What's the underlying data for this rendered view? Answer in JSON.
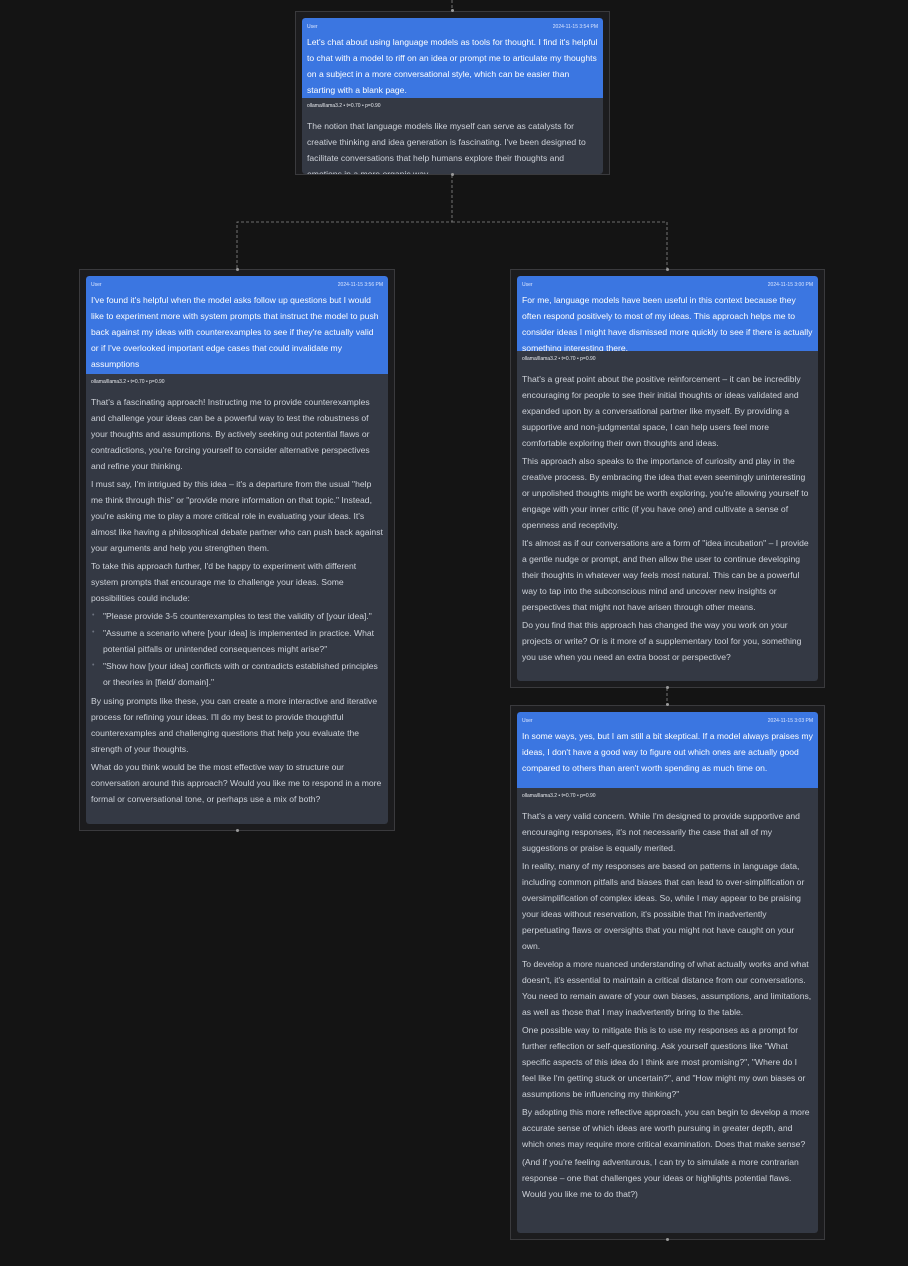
{
  "nodes": {
    "root": {
      "user": {
        "role": "User",
        "timestamp": "2024-11-15 3:54 PM",
        "text": "Let's chat about using language models as tools for thought. I find it's helpful to chat with a model to riff on an idea or prompt me to articulate my thoughts on a subject in a more conversational style, which can be easier than starting with a blank page."
      },
      "assistant": {
        "model": "ollama/llama3.2 • t=0.70 • p=0.90",
        "paragraphs": [
          "The notion that language models like myself can serve as catalysts for creative thinking and idea generation is fascinating. I've been designed to facilitate conversations that help humans explore their thoughts and emotions in a more organic way."
        ]
      }
    },
    "left": {
      "user": {
        "role": "User",
        "timestamp": "2024-11-15 3:56 PM",
        "text": "I've found it's helpful when the model asks follow up questions but I would like to experiment more with system prompts that instruct the model to push back against my ideas with counterexamples to see if they're actually valid or if I've overlooked important edge cases that could invalidate my assumptions"
      },
      "assistant": {
        "model": "ollama/llama3.2 • t=0.70 • p=0.90",
        "p1": "That's a fascinating approach! Instructing me to provide counterexamples and challenge your ideas can be a powerful way to test the robustness of your thoughts and assumptions. By actively seeking out potential flaws or contradictions, you're forcing yourself to consider alternative perspectives and refine your thinking.",
        "p2": "I must say, I'm intrigued by this idea – it's a departure from the usual \"help me think through this\" or \"provide more information on that topic.\" Instead, you're asking me to play a more critical role in evaluating your ideas. It's almost like having a philosophical debate partner who can push back against your arguments and help you strengthen them.",
        "p3": "To take this approach further, I'd be happy to experiment with different system prompts that encourage me to challenge your ideas. Some possibilities could include:",
        "bullets": [
          "\"Please provide 3-5 counterexamples to test the validity of [your idea].\"",
          "\"Assume a scenario where [your idea] is implemented in practice. What potential pitfalls or unintended consequences might arise?\"",
          "\"Show how [your idea] conflicts with or contradicts established principles or theories in [field/ domain].\""
        ],
        "p4": "By using prompts like these, you can create a more interactive and iterative process for refining your ideas. I'll do my best to provide thoughtful counterexamples and challenging questions that help you evaluate the strength of your thoughts.",
        "p5": "What do you think would be the most effective way to structure our conversation around this approach? Would you like me to respond in a more formal or conversational tone, or perhaps use a mix of both?"
      }
    },
    "right_top": {
      "user": {
        "role": "User",
        "timestamp": "2024-11-15 3:00 PM",
        "text": "For me, language models have been useful in this context because they often respond positively to most of my ideas. This approach helps me to consider ideas I might have dismissed more quickly to see if there is actually something interesting there."
      },
      "assistant": {
        "model": "ollama/llama3.2 • t=0.70 • p=0.90",
        "paragraphs": [
          "That's a great point about the positive reinforcement – it can be incredibly encouraging for people to see their initial thoughts or ideas validated and expanded upon by a conversational partner like myself. By providing a supportive and non-judgmental space, I can help users feel more comfortable exploring their own thoughts and ideas.",
          "This approach also speaks to the importance of curiosity and play in the creative process. By embracing the idea that even seemingly uninteresting or unpolished thoughts might be worth exploring, you're allowing yourself to engage with your inner critic (if you have one) and cultivate a sense of openness and receptivity.",
          "It's almost as if our conversations are a form of \"idea incubation\" – I provide a gentle nudge or prompt, and then allow the user to continue developing their thoughts in whatever way feels most natural. This can be a powerful way to tap into the subconscious mind and uncover new insights or perspectives that might not have arisen through other means.",
          "Do you find that this approach has changed the way you work on your projects or write? Or is it more of a supplementary tool for you, something you use when you need an extra boost or perspective?"
        ]
      }
    },
    "right_bottom": {
      "user": {
        "role": "User",
        "timestamp": "2024-11-15 3:03 PM",
        "text": "In some ways, yes, but I am still a bit skeptical. If a model always praises my ideas, I don't have a good way to figure out which ones are actually good compared to others than aren't worth spending as much time on."
      },
      "assistant": {
        "model": "ollama/llama3.2 • t=0.70 • p=0.90",
        "paragraphs": [
          "That's a very valid concern. While I'm designed to provide supportive and encouraging responses, it's not necessarily the case that all of my suggestions or praise is equally merited.",
          "In reality, many of my responses are based on patterns in language data, including common pitfalls and biases that can lead to over-simplification or oversimplification of complex ideas. So, while I may appear to be praising your ideas without reservation, it's possible that I'm inadvertently perpetuating flaws or oversights that you might not have caught on your own.",
          "To develop a more nuanced understanding of what actually works and what doesn't, it's essential to maintain a critical distance from our conversations. You need to remain aware of your own biases, assumptions, and limitations, as well as those that I may inadvertently bring to the table.",
          "One possible way to mitigate this is to use my responses as a prompt for further reflection or self-questioning. Ask yourself questions like \"What specific aspects of this idea do I think are most promising?\", \"Where do I feel like I'm getting stuck or uncertain?\", and \"How might my own biases or assumptions be influencing my thinking?\"",
          "By adopting this more reflective approach, you can begin to develop a more accurate sense of which ideas are worth pursuing in greater depth, and which ones may require more critical examination. Does that make sense?",
          "(And if you're feeling adventurous, I can try to simulate a more contrarian response – one that challenges your ideas or highlights potential flaws. Would you like me to do that?)"
        ]
      }
    }
  },
  "colors": {
    "canvas_bg": "#141414",
    "node_bg": "#1c1c1e",
    "user_bubble": "#3b76e1",
    "assistant_bubble": "#343944",
    "edge": "#8a8a8a"
  }
}
